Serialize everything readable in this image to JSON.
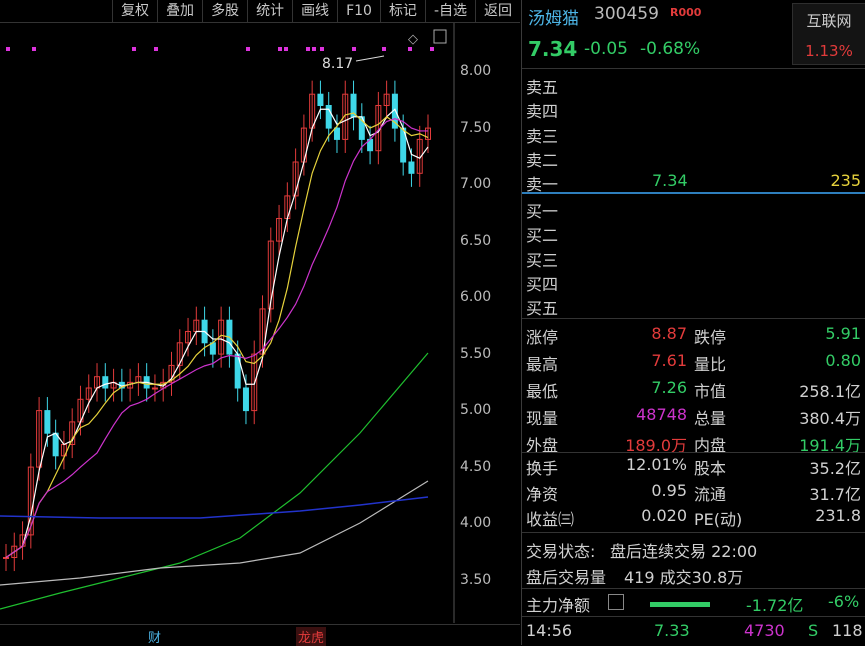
{
  "toolbar": {
    "buttons": [
      "复权",
      "叠加",
      "多股",
      "统计",
      "画线",
      "F10",
      "标记",
      "-自选",
      "返回"
    ]
  },
  "chart": {
    "price_ticks": [
      "8.00",
      "7.50",
      "7.00",
      "6.50",
      "6.00",
      "5.50",
      "5.00",
      "4.50",
      "4.00",
      "3.50"
    ],
    "high_annotation": "8.17",
    "tags": {
      "finance": "财",
      "longhu": "龙虎"
    },
    "colors": {
      "up": "#e23b3b",
      "down": "#3fd7e8",
      "ma5": "#ffffff",
      "ma10": "#e6d23c",
      "ma20": "#cc33cc",
      "ma60": "#1fbf2f",
      "ma120": "#bbbbbb",
      "ma250": "#2233cc"
    }
  },
  "quote": {
    "name": "汤姆猫",
    "code": "300459",
    "flag": "R000",
    "price": "7.34",
    "change": "-0.05",
    "change_pct": "-0.68%",
    "sector": {
      "name": "互联网",
      "change": "1.13%"
    },
    "asks": [
      {
        "label": "卖五",
        "price": "",
        "vol": ""
      },
      {
        "label": "卖四",
        "price": "",
        "vol": ""
      },
      {
        "label": "卖三",
        "price": "",
        "vol": ""
      },
      {
        "label": "卖二",
        "price": "",
        "vol": ""
      },
      {
        "label": "卖一",
        "price": "7.34",
        "vol": "235"
      }
    ],
    "bids": [
      {
        "label": "买一",
        "price": "",
        "vol": ""
      },
      {
        "label": "买二",
        "price": "",
        "vol": ""
      },
      {
        "label": "买三",
        "price": "",
        "vol": ""
      },
      {
        "label": "买四",
        "price": "",
        "vol": ""
      },
      {
        "label": "买五",
        "price": "",
        "vol": ""
      }
    ],
    "stats_a": [
      {
        "l1": "涨停",
        "v1": "8.87",
        "l2": "跌停",
        "v2": "5.91"
      },
      {
        "l1": "最高",
        "v1": "7.61",
        "l2": "量比",
        "v2": "0.80"
      },
      {
        "l1": "最低",
        "v1": "7.26",
        "l2": "市值",
        "v2": "258.1亿"
      },
      {
        "l1": "现量",
        "v1": "48748",
        "l2": "总量",
        "v2": "380.4万"
      },
      {
        "l1": "外盘",
        "v1": "189.0万",
        "l2": "内盘",
        "v2": "191.4万"
      }
    ],
    "stats_b": [
      {
        "l1": "换手",
        "v1": "12.01%",
        "l2": "股本",
        "v2": "35.2亿"
      },
      {
        "l1": "净资",
        "v1": "0.95",
        "l2": "流通",
        "v2": "31.7亿"
      },
      {
        "l1": "收益㈢",
        "v1": "0.020",
        "l2": "PE(动)",
        "v2": "231.8"
      }
    ],
    "trade_status_label": "交易状态:",
    "trade_status_value": "盘后连续交易 22:00",
    "after_volume_label": "盘后交易量",
    "after_volume_value": "419 成交30.8万",
    "main_flow_label": "主力净额",
    "main_flow_value": "-1.72亿",
    "main_flow_pct": "-6%",
    "last_tick": {
      "time": "14:56",
      "price": "7.33",
      "vol": "4730",
      "side": "S",
      "count": "118"
    }
  }
}
